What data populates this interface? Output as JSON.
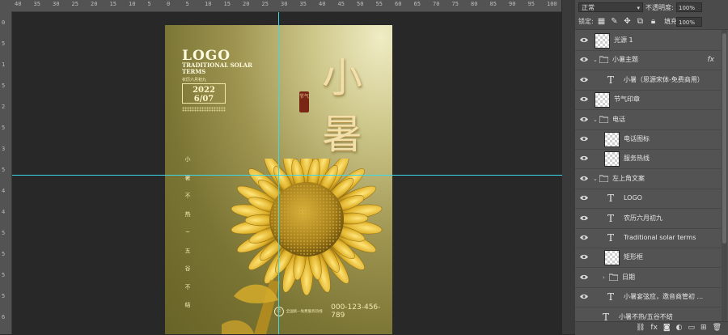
{
  "ruler": {
    "top_labels": [
      "40",
      "35",
      "30",
      "25",
      "20",
      "15",
      "10",
      "5",
      "0",
      "5",
      "10",
      "15",
      "20",
      "25",
      "30",
      "35",
      "40",
      "45",
      "50",
      "55",
      "60",
      "65",
      "70",
      "75",
      "80",
      "85",
      "90",
      "95",
      "100",
      "10"
    ],
    "left_labels": [
      "0",
      "5",
      "1",
      "5",
      "2",
      "5",
      "3",
      "5",
      "4",
      "4",
      "5",
      "5",
      "5",
      "5",
      "6"
    ]
  },
  "poster": {
    "logo": "LOGO",
    "traditional": "TRADITIONAL SOLAR TERMS",
    "lunar_date": "农历六月初九",
    "date_year": "2022",
    "date_md": "6/07",
    "title_line1": "小",
    "title_line2": "暑",
    "seal_text": "节气",
    "vertical_text": [
      "小",
      "暑",
      "不",
      "热",
      "~",
      "五",
      "谷",
      "不",
      "结"
    ],
    "phone_label": "全国统一免费服务热线",
    "phone_number": "000-123-456-789"
  },
  "panel": {
    "blend_mode": "正常",
    "opacity_label": "不透明度:",
    "opacity_value": "100%",
    "lock_label": "锁定:",
    "fill_label": "填充:",
    "fill_value": "100%",
    "layers": [
      {
        "name": "光源 1",
        "kind": "image"
      },
      {
        "name": "小暑主题",
        "kind": "group",
        "fx": "fx"
      },
      {
        "name": "小暑（思源宋体-免费商用）",
        "kind": "text"
      },
      {
        "name": "节气印章",
        "kind": "image"
      },
      {
        "name": "电话",
        "kind": "group"
      },
      {
        "name": "电话图标",
        "kind": "image"
      },
      {
        "name": "服务热线",
        "kind": "image"
      },
      {
        "name": "左上角文案",
        "kind": "group"
      },
      {
        "name": "LOGO",
        "kind": "text"
      },
      {
        "name": "农历六月初九",
        "kind": "text"
      },
      {
        "name": "Traditional solar terms",
        "kind": "text"
      },
      {
        "name": "矩形框",
        "kind": "image"
      },
      {
        "name": "日期",
        "kind": "group"
      },
      {
        "name": "小暑宴弦应，邀音商管初 ...",
        "kind": "text"
      },
      {
        "name": "小暑不热/五谷不结",
        "kind": "text"
      }
    ]
  },
  "colors": {
    "guide": "#3ad8e8",
    "panel_bg": "#535353",
    "canvas_bg": "#282828",
    "gold_text": "#f2dfaa"
  }
}
